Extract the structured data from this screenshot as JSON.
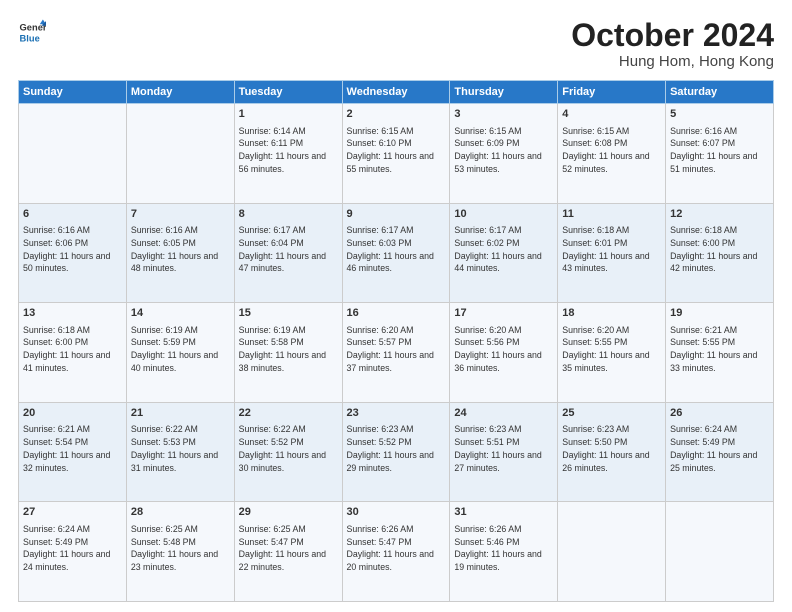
{
  "header": {
    "logo_line1": "General",
    "logo_line2": "Blue",
    "month": "October 2024",
    "location": "Hung Hom, Hong Kong"
  },
  "days_of_week": [
    "Sunday",
    "Monday",
    "Tuesday",
    "Wednesday",
    "Thursday",
    "Friday",
    "Saturday"
  ],
  "weeks": [
    [
      {
        "day": "",
        "info": ""
      },
      {
        "day": "",
        "info": ""
      },
      {
        "day": "1",
        "info": "Sunrise: 6:14 AM\nSunset: 6:11 PM\nDaylight: 11 hours and 56 minutes."
      },
      {
        "day": "2",
        "info": "Sunrise: 6:15 AM\nSunset: 6:10 PM\nDaylight: 11 hours and 55 minutes."
      },
      {
        "day": "3",
        "info": "Sunrise: 6:15 AM\nSunset: 6:09 PM\nDaylight: 11 hours and 53 minutes."
      },
      {
        "day": "4",
        "info": "Sunrise: 6:15 AM\nSunset: 6:08 PM\nDaylight: 11 hours and 52 minutes."
      },
      {
        "day": "5",
        "info": "Sunrise: 6:16 AM\nSunset: 6:07 PM\nDaylight: 11 hours and 51 minutes."
      }
    ],
    [
      {
        "day": "6",
        "info": "Sunrise: 6:16 AM\nSunset: 6:06 PM\nDaylight: 11 hours and 50 minutes."
      },
      {
        "day": "7",
        "info": "Sunrise: 6:16 AM\nSunset: 6:05 PM\nDaylight: 11 hours and 48 minutes."
      },
      {
        "day": "8",
        "info": "Sunrise: 6:17 AM\nSunset: 6:04 PM\nDaylight: 11 hours and 47 minutes."
      },
      {
        "day": "9",
        "info": "Sunrise: 6:17 AM\nSunset: 6:03 PM\nDaylight: 11 hours and 46 minutes."
      },
      {
        "day": "10",
        "info": "Sunrise: 6:17 AM\nSunset: 6:02 PM\nDaylight: 11 hours and 44 minutes."
      },
      {
        "day": "11",
        "info": "Sunrise: 6:18 AM\nSunset: 6:01 PM\nDaylight: 11 hours and 43 minutes."
      },
      {
        "day": "12",
        "info": "Sunrise: 6:18 AM\nSunset: 6:00 PM\nDaylight: 11 hours and 42 minutes."
      }
    ],
    [
      {
        "day": "13",
        "info": "Sunrise: 6:18 AM\nSunset: 6:00 PM\nDaylight: 11 hours and 41 minutes."
      },
      {
        "day": "14",
        "info": "Sunrise: 6:19 AM\nSunset: 5:59 PM\nDaylight: 11 hours and 40 minutes."
      },
      {
        "day": "15",
        "info": "Sunrise: 6:19 AM\nSunset: 5:58 PM\nDaylight: 11 hours and 38 minutes."
      },
      {
        "day": "16",
        "info": "Sunrise: 6:20 AM\nSunset: 5:57 PM\nDaylight: 11 hours and 37 minutes."
      },
      {
        "day": "17",
        "info": "Sunrise: 6:20 AM\nSunset: 5:56 PM\nDaylight: 11 hours and 36 minutes."
      },
      {
        "day": "18",
        "info": "Sunrise: 6:20 AM\nSunset: 5:55 PM\nDaylight: 11 hours and 35 minutes."
      },
      {
        "day": "19",
        "info": "Sunrise: 6:21 AM\nSunset: 5:55 PM\nDaylight: 11 hours and 33 minutes."
      }
    ],
    [
      {
        "day": "20",
        "info": "Sunrise: 6:21 AM\nSunset: 5:54 PM\nDaylight: 11 hours and 32 minutes."
      },
      {
        "day": "21",
        "info": "Sunrise: 6:22 AM\nSunset: 5:53 PM\nDaylight: 11 hours and 31 minutes."
      },
      {
        "day": "22",
        "info": "Sunrise: 6:22 AM\nSunset: 5:52 PM\nDaylight: 11 hours and 30 minutes."
      },
      {
        "day": "23",
        "info": "Sunrise: 6:23 AM\nSunset: 5:52 PM\nDaylight: 11 hours and 29 minutes."
      },
      {
        "day": "24",
        "info": "Sunrise: 6:23 AM\nSunset: 5:51 PM\nDaylight: 11 hours and 27 minutes."
      },
      {
        "day": "25",
        "info": "Sunrise: 6:23 AM\nSunset: 5:50 PM\nDaylight: 11 hours and 26 minutes."
      },
      {
        "day": "26",
        "info": "Sunrise: 6:24 AM\nSunset: 5:49 PM\nDaylight: 11 hours and 25 minutes."
      }
    ],
    [
      {
        "day": "27",
        "info": "Sunrise: 6:24 AM\nSunset: 5:49 PM\nDaylight: 11 hours and 24 minutes."
      },
      {
        "day": "28",
        "info": "Sunrise: 6:25 AM\nSunset: 5:48 PM\nDaylight: 11 hours and 23 minutes."
      },
      {
        "day": "29",
        "info": "Sunrise: 6:25 AM\nSunset: 5:47 PM\nDaylight: 11 hours and 22 minutes."
      },
      {
        "day": "30",
        "info": "Sunrise: 6:26 AM\nSunset: 5:47 PM\nDaylight: 11 hours and 20 minutes."
      },
      {
        "day": "31",
        "info": "Sunrise: 6:26 AM\nSunset: 5:46 PM\nDaylight: 11 hours and 19 minutes."
      },
      {
        "day": "",
        "info": ""
      },
      {
        "day": "",
        "info": ""
      }
    ]
  ]
}
